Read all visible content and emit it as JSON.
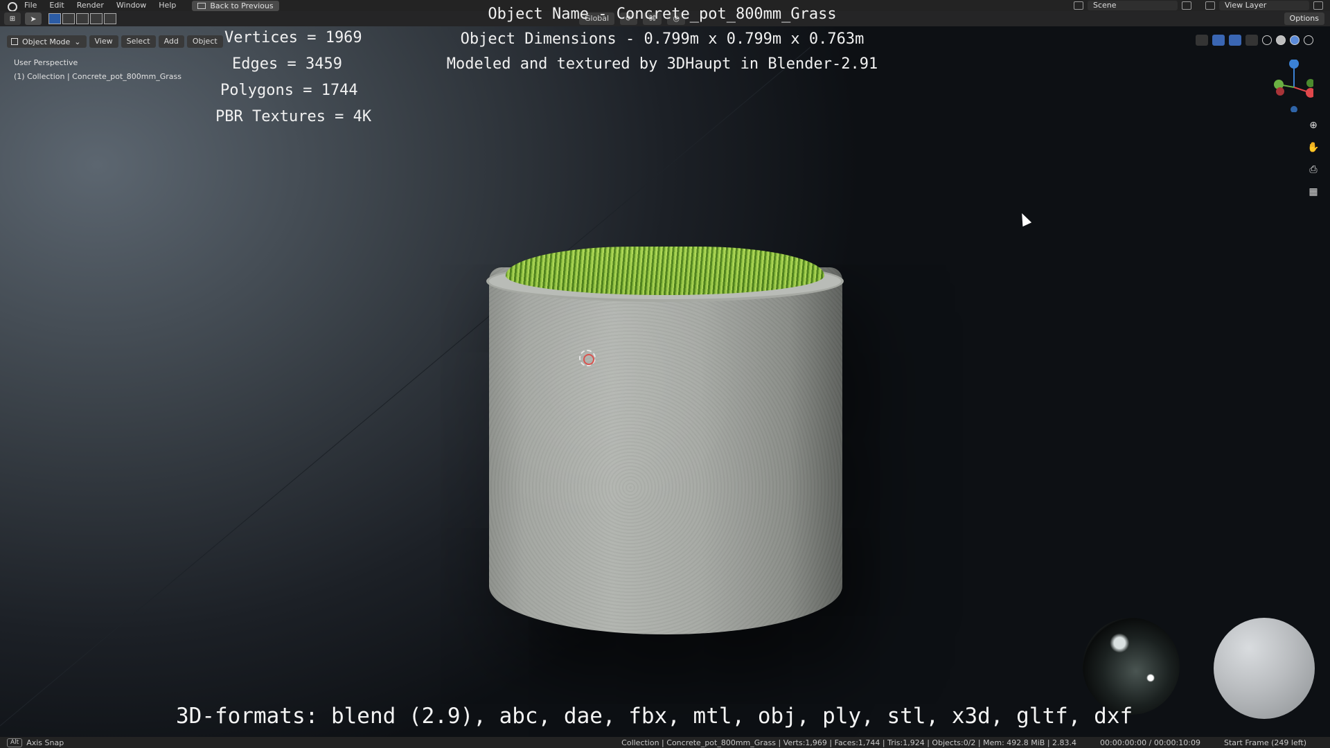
{
  "topbar": {
    "menus": [
      "File",
      "Edit",
      "Render",
      "Window",
      "Help"
    ],
    "back_button": "Back to Previous",
    "scene": "Scene",
    "view_layer": "View Layer"
  },
  "header": {
    "transform_orientation": "Global",
    "options": "Options",
    "mode": "Object Mode",
    "menus": [
      "View",
      "Select",
      "Add",
      "Object"
    ]
  },
  "viewport": {
    "perspective": "User Perspective",
    "collection": "(1) Collection | Concrete_pot_800mm_Grass"
  },
  "overlay_text": {
    "stats": [
      "Vertices = 1969",
      "Edges = 3459",
      "Polygons = 1744",
      "PBR Textures = 4K"
    ],
    "info": [
      "Object Name - Concrete_pot_800mm_Grass",
      "Object Dimensions -  0.799m x 0.799m x 0.763m",
      "Modeled and textured by 3DHaupt in Blender-2.91"
    ],
    "formats": "3D-formats: blend (2.9), abc, dae, fbx, mtl, obj, ply, stl, x3d, gltf, dxf"
  },
  "statusbar": {
    "alt": "Alt",
    "left": "Axis Snap",
    "collection_stats": "Collection | Concrete_pot_800mm_Grass | Verts:1,969 | Faces:1,744 | Tris:1,924 | Objects:0/2 | Mem: 492.8 MiB | 2.83.4",
    "time": "00:00:00:00 / 00:00:10:09",
    "start_frame": "Start Frame (249 left)"
  },
  "icons": {
    "gizmo_colors": {
      "x": "#e0474b",
      "y": "#6bb043",
      "z": "#3b82d6"
    }
  }
}
